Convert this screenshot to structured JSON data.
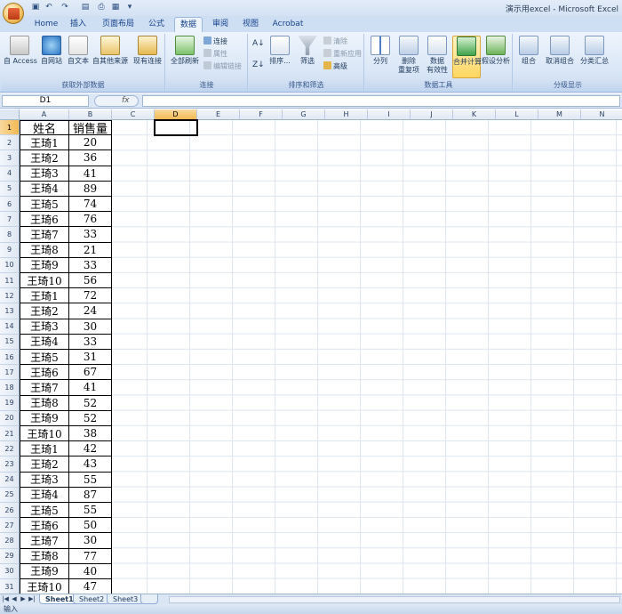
{
  "window": {
    "title": "演示用excel - Microsoft Excel"
  },
  "quick_access": [
    "save-icon",
    "undo-icon",
    "redo-icon",
    "print-preview-icon",
    "quick-print-icon",
    "customize-icon"
  ],
  "tabs": [
    {
      "label": "Home"
    },
    {
      "label": "插入"
    },
    {
      "label": "页面布局"
    },
    {
      "label": "公式"
    },
    {
      "label": "数据",
      "active": true
    },
    {
      "label": "审阅"
    },
    {
      "label": "视图"
    },
    {
      "label": "Acrobat"
    }
  ],
  "ribbon": {
    "groups": [
      {
        "label": "获取外部数据",
        "buttons": [
          "自 Access",
          "自网站",
          "自文本",
          "自其他来源",
          "现有连接"
        ]
      },
      {
        "label": "连接",
        "buttons": [
          "全部刷新"
        ],
        "small": [
          "连接",
          "属性",
          "编辑链接"
        ]
      },
      {
        "label": "排序和筛选",
        "buttons": [
          "排序...",
          "筛选"
        ],
        "small": [
          "清除",
          "重新应用",
          "高级"
        ]
      },
      {
        "label": "数据工具",
        "buttons": [
          "分列",
          "删除",
          "重复项",
          "数据",
          "有效性",
          "合并计算",
          "假设分析"
        ]
      },
      {
        "label": "分级显示",
        "buttons": [
          "组合",
          "取消组合",
          "分类汇总"
        ]
      }
    ],
    "hovered_button": "合并计算"
  },
  "formula_bar": {
    "name_box": "D1",
    "fx": "fx",
    "content": ""
  },
  "grid": {
    "columns": [
      "A",
      "B",
      "C",
      "D",
      "E",
      "F",
      "G",
      "H",
      "I",
      "J",
      "K",
      "L",
      "M",
      "N"
    ],
    "selected_column": "D",
    "selected_cell": "D1",
    "row_numbers": [
      "1",
      "2",
      "3",
      "4",
      "5",
      "6",
      "7",
      "8",
      "9",
      "10",
      "11",
      "12",
      "13",
      "14",
      "15",
      "16",
      "17",
      "18",
      "19",
      "20",
      "21",
      "22",
      "23",
      "24",
      "25",
      "26",
      "27",
      "28",
      "29",
      "30",
      "31"
    ],
    "header": {
      "name": "姓名",
      "sales": "销售量"
    },
    "rows": [
      {
        "name": "王琦1",
        "sales": "20"
      },
      {
        "name": "王琦2",
        "sales": "36"
      },
      {
        "name": "王琦3",
        "sales": "41"
      },
      {
        "name": "王琦4",
        "sales": "89"
      },
      {
        "name": "王琦5",
        "sales": "74"
      },
      {
        "name": "王琦6",
        "sales": "76"
      },
      {
        "name": "王琦7",
        "sales": "33"
      },
      {
        "name": "王琦8",
        "sales": "21"
      },
      {
        "name": "王琦9",
        "sales": "33"
      },
      {
        "name": "王琦10",
        "sales": "56"
      },
      {
        "name": "王琦1",
        "sales": "72"
      },
      {
        "name": "王琦2",
        "sales": "24"
      },
      {
        "name": "王琦3",
        "sales": "30"
      },
      {
        "name": "王琦4",
        "sales": "33"
      },
      {
        "name": "王琦5",
        "sales": "31"
      },
      {
        "name": "王琦6",
        "sales": "67"
      },
      {
        "name": "王琦7",
        "sales": "41"
      },
      {
        "name": "王琦8",
        "sales": "52"
      },
      {
        "name": "王琦9",
        "sales": "52"
      },
      {
        "name": "王琦10",
        "sales": "38"
      },
      {
        "name": "王琦1",
        "sales": "42"
      },
      {
        "name": "王琦2",
        "sales": "43"
      },
      {
        "name": "王琦3",
        "sales": "55"
      },
      {
        "name": "王琦4",
        "sales": "87"
      },
      {
        "name": "王琦5",
        "sales": "55"
      },
      {
        "name": "王琦6",
        "sales": "50"
      },
      {
        "name": "王琦7",
        "sales": "30"
      },
      {
        "name": "王琦8",
        "sales": "77"
      },
      {
        "name": "王琦9",
        "sales": "40"
      },
      {
        "name": "王琦10",
        "sales": "47"
      }
    ]
  },
  "sheets": [
    {
      "label": "Sheet1",
      "active": true
    },
    {
      "label": "Sheet2"
    },
    {
      "label": "Sheet3"
    }
  ],
  "status": {
    "mode": "输入"
  }
}
